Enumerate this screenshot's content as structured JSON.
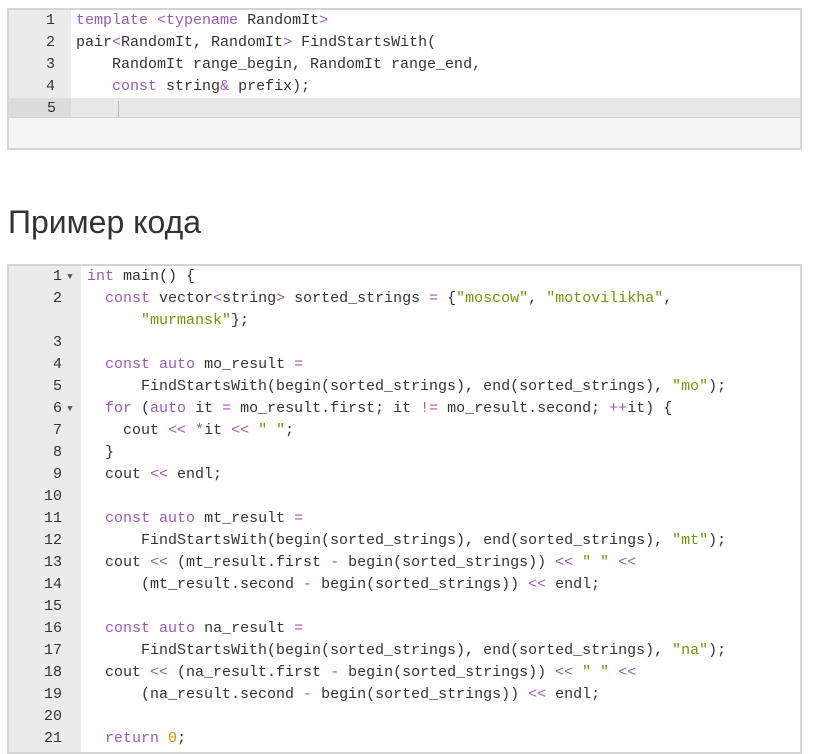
{
  "snippet": {
    "lines": [
      {
        "n": "1",
        "tokens": [
          {
            "t": "template",
            "c": "kw"
          },
          {
            "t": " ",
            "c": "plain"
          },
          {
            "t": "<",
            "c": "op"
          },
          {
            "t": "typename",
            "c": "kw"
          },
          {
            "t": " RandomIt",
            "c": "plain"
          },
          {
            "t": ">",
            "c": "op"
          }
        ]
      },
      {
        "n": "2",
        "tokens": [
          {
            "t": "pair",
            "c": "plain"
          },
          {
            "t": "<",
            "c": "op"
          },
          {
            "t": "RandomIt, RandomIt",
            "c": "plain"
          },
          {
            "t": ">",
            "c": "op"
          },
          {
            "t": " FindStartsWith(",
            "c": "plain"
          }
        ]
      },
      {
        "n": "3",
        "tokens": [
          {
            "t": "    RandomIt range_begin, RandomIt range_end,",
            "c": "plain"
          }
        ]
      },
      {
        "n": "4",
        "tokens": [
          {
            "t": "    ",
            "c": "plain"
          },
          {
            "t": "const",
            "c": "kw"
          },
          {
            "t": " string",
            "c": "plain"
          },
          {
            "t": "&",
            "c": "op"
          },
          {
            "t": " prefix);",
            "c": "plain"
          }
        ]
      },
      {
        "n": "5",
        "active": true,
        "tokens": []
      }
    ]
  },
  "section_heading": "Пример кода",
  "example": {
    "lines": [
      {
        "n": "1",
        "fold": true,
        "tokens": [
          {
            "t": "int",
            "c": "kw"
          },
          {
            "t": " main() {",
            "c": "plain"
          }
        ]
      },
      {
        "n": "2",
        "tokens": [
          {
            "t": "  ",
            "c": "plain"
          },
          {
            "t": "const",
            "c": "kw"
          },
          {
            "t": " vector",
            "c": "plain"
          },
          {
            "t": "<",
            "c": "op"
          },
          {
            "t": "string",
            "c": "plain"
          },
          {
            "t": ">",
            "c": "op"
          },
          {
            "t": " sorted_strings ",
            "c": "plain"
          },
          {
            "t": "=",
            "c": "op"
          },
          {
            "t": " {",
            "c": "plain"
          },
          {
            "t": "\"moscow\"",
            "c": "str"
          },
          {
            "t": ", ",
            "c": "plain"
          },
          {
            "t": "\"motovilikha\"",
            "c": "str"
          },
          {
            "t": ",",
            "c": "plain"
          }
        ]
      },
      {
        "n": "",
        "tokens": [
          {
            "t": "      ",
            "c": "plain"
          },
          {
            "t": "\"murmansk\"",
            "c": "str"
          },
          {
            "t": "};",
            "c": "plain"
          }
        ]
      },
      {
        "n": "3",
        "tokens": []
      },
      {
        "n": "4",
        "tokens": [
          {
            "t": "  ",
            "c": "plain"
          },
          {
            "t": "const",
            "c": "kw"
          },
          {
            "t": " ",
            "c": "plain"
          },
          {
            "t": "auto",
            "c": "kw"
          },
          {
            "t": " mo_result ",
            "c": "plain"
          },
          {
            "t": "=",
            "c": "op"
          }
        ]
      },
      {
        "n": "5",
        "tokens": [
          {
            "t": "      FindStartsWith(begin(sorted_strings), end(sorted_strings), ",
            "c": "plain"
          },
          {
            "t": "\"mo\"",
            "c": "str"
          },
          {
            "t": ");",
            "c": "plain"
          }
        ]
      },
      {
        "n": "6",
        "fold": true,
        "tokens": [
          {
            "t": "  ",
            "c": "plain"
          },
          {
            "t": "for",
            "c": "kw"
          },
          {
            "t": " (",
            "c": "plain"
          },
          {
            "t": "auto",
            "c": "kw"
          },
          {
            "t": " it ",
            "c": "plain"
          },
          {
            "t": "=",
            "c": "op"
          },
          {
            "t": " mo_result.first; it ",
            "c": "plain"
          },
          {
            "t": "!=",
            "c": "op"
          },
          {
            "t": " mo_result.second; ",
            "c": "plain"
          },
          {
            "t": "++",
            "c": "op"
          },
          {
            "t": "it) {",
            "c": "plain"
          }
        ]
      },
      {
        "n": "7",
        "tokens": [
          {
            "t": "    cout ",
            "c": "plain"
          },
          {
            "t": "<<",
            "c": "op"
          },
          {
            "t": " ",
            "c": "plain"
          },
          {
            "t": "*",
            "c": "op"
          },
          {
            "t": "it ",
            "c": "plain"
          },
          {
            "t": "<<",
            "c": "op"
          },
          {
            "t": " ",
            "c": "plain"
          },
          {
            "t": "\" \"",
            "c": "str"
          },
          {
            "t": ";",
            "c": "plain"
          }
        ]
      },
      {
        "n": "8",
        "tokens": [
          {
            "t": "  }",
            "c": "plain"
          }
        ]
      },
      {
        "n": "9",
        "tokens": [
          {
            "t": "  cout ",
            "c": "plain"
          },
          {
            "t": "<<",
            "c": "op"
          },
          {
            "t": " endl;",
            "c": "plain"
          }
        ]
      },
      {
        "n": "10",
        "tokens": []
      },
      {
        "n": "11",
        "tokens": [
          {
            "t": "  ",
            "c": "plain"
          },
          {
            "t": "const",
            "c": "kw"
          },
          {
            "t": " ",
            "c": "plain"
          },
          {
            "t": "auto",
            "c": "kw"
          },
          {
            "t": " mt_result ",
            "c": "plain"
          },
          {
            "t": "=",
            "c": "op"
          }
        ]
      },
      {
        "n": "12",
        "tokens": [
          {
            "t": "      FindStartsWith(begin(sorted_strings), end(sorted_strings), ",
            "c": "plain"
          },
          {
            "t": "\"mt\"",
            "c": "str"
          },
          {
            "t": ");",
            "c": "plain"
          }
        ]
      },
      {
        "n": "13",
        "tokens": [
          {
            "t": "  cout ",
            "c": "plain"
          },
          {
            "t": "<<",
            "c": "op"
          },
          {
            "t": " (mt_result.first ",
            "c": "plain"
          },
          {
            "t": "-",
            "c": "op"
          },
          {
            "t": " begin(sorted_strings)) ",
            "c": "plain"
          },
          {
            "t": "<<",
            "c": "op"
          },
          {
            "t": " ",
            "c": "plain"
          },
          {
            "t": "\" \"",
            "c": "str"
          },
          {
            "t": " ",
            "c": "plain"
          },
          {
            "t": "<<",
            "c": "op"
          }
        ]
      },
      {
        "n": "14",
        "tokens": [
          {
            "t": "      (mt_result.second ",
            "c": "plain"
          },
          {
            "t": "-",
            "c": "op"
          },
          {
            "t": " begin(sorted_strings)) ",
            "c": "plain"
          },
          {
            "t": "<<",
            "c": "op"
          },
          {
            "t": " endl;",
            "c": "plain"
          }
        ]
      },
      {
        "n": "15",
        "tokens": []
      },
      {
        "n": "16",
        "tokens": [
          {
            "t": "  ",
            "c": "plain"
          },
          {
            "t": "const",
            "c": "kw"
          },
          {
            "t": " ",
            "c": "plain"
          },
          {
            "t": "auto",
            "c": "kw"
          },
          {
            "t": " na_result ",
            "c": "plain"
          },
          {
            "t": "=",
            "c": "op"
          }
        ]
      },
      {
        "n": "17",
        "tokens": [
          {
            "t": "      FindStartsWith(begin(sorted_strings), end(sorted_strings), ",
            "c": "plain"
          },
          {
            "t": "\"na\"",
            "c": "str"
          },
          {
            "t": ");",
            "c": "plain"
          }
        ]
      },
      {
        "n": "18",
        "tokens": [
          {
            "t": "  cout ",
            "c": "plain"
          },
          {
            "t": "<<",
            "c": "op"
          },
          {
            "t": " (na_result.first ",
            "c": "plain"
          },
          {
            "t": "-",
            "c": "op"
          },
          {
            "t": " begin(sorted_strings)) ",
            "c": "plain"
          },
          {
            "t": "<<",
            "c": "op"
          },
          {
            "t": " ",
            "c": "plain"
          },
          {
            "t": "\" \"",
            "c": "str"
          },
          {
            "t": " ",
            "c": "plain"
          },
          {
            "t": "<<",
            "c": "op"
          }
        ]
      },
      {
        "n": "19",
        "tokens": [
          {
            "t": "      (na_result.second ",
            "c": "plain"
          },
          {
            "t": "-",
            "c": "op"
          },
          {
            "t": " begin(sorted_strings)) ",
            "c": "plain"
          },
          {
            "t": "<<",
            "c": "op"
          },
          {
            "t": " endl;",
            "c": "plain"
          }
        ]
      },
      {
        "n": "20",
        "tokens": []
      },
      {
        "n": "21",
        "tokens": [
          {
            "t": "  ",
            "c": "plain"
          },
          {
            "t": "return",
            "c": "kw"
          },
          {
            "t": " ",
            "c": "plain"
          },
          {
            "t": "0",
            "c": "num"
          },
          {
            "t": ";",
            "c": "plain"
          }
        ]
      }
    ]
  },
  "colors": {
    "keyword": "#9b59b6",
    "operator": "#9b59b6",
    "string": "#6a9a00",
    "number": "#e08600",
    "gutter": "#ebebeb"
  }
}
